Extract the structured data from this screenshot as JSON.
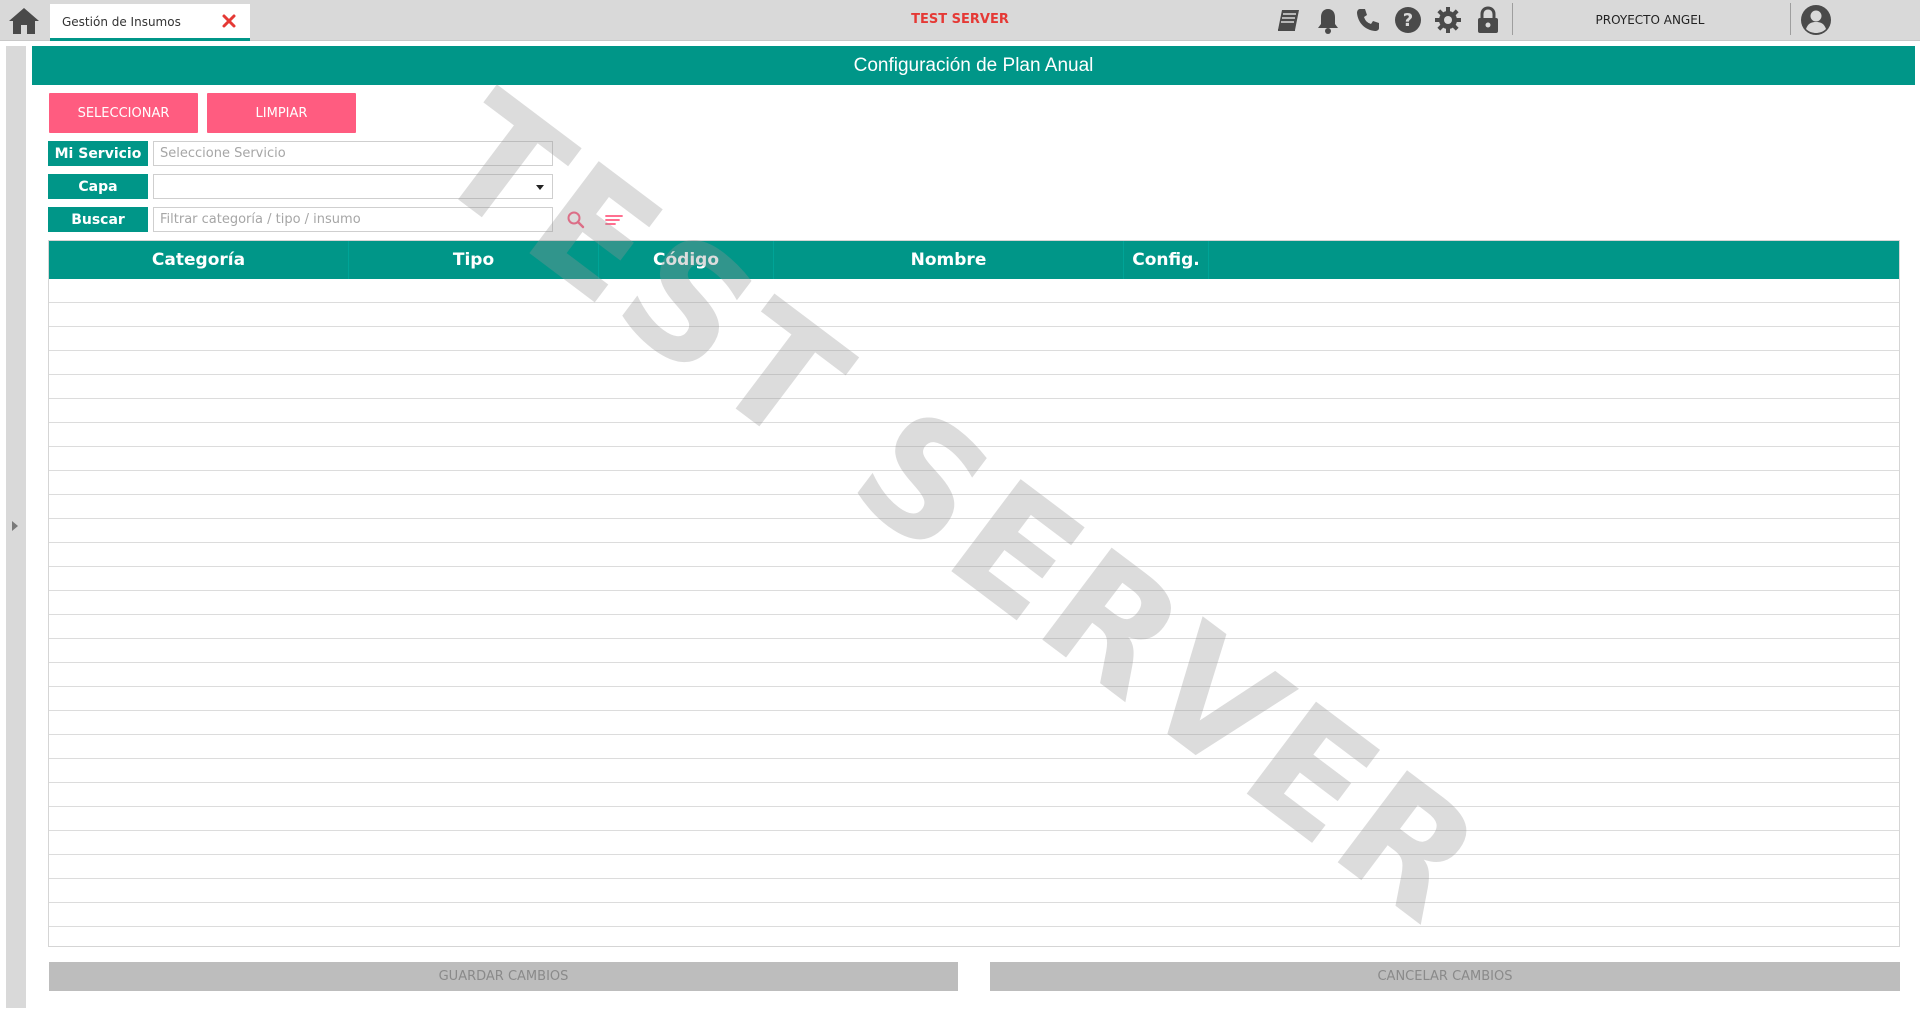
{
  "tabs": [
    {
      "label": "Gestión de Insumos",
      "active": true
    }
  ],
  "topbar": {
    "server_label": "TEST SERVER",
    "project_label": "PROYECTO ANGEL",
    "icons": [
      "home-icon",
      "book-icon",
      "bell-icon",
      "phone-icon",
      "help-icon",
      "gear-icon",
      "lock-icon",
      "user-avatar-icon"
    ]
  },
  "panel": {
    "title": "Configuración de Plan Anual"
  },
  "actions": {
    "select_label": "SELECCIONAR",
    "clear_label": "LIMPIAR"
  },
  "form": {
    "servicio_label": "Mi Servicio",
    "servicio_placeholder": "Seleccione Servicio",
    "capa_label": "Capa",
    "capa_value": "",
    "buscar_label": "Buscar",
    "buscar_placeholder": "Filtrar categoría / tipo / insumo"
  },
  "grid": {
    "columns": [
      "Categoría",
      "Tipo",
      "Código",
      "Nombre",
      "Config."
    ],
    "rows": []
  },
  "watermark": "TEST SERVER",
  "footer": {
    "save_label": "GUARDAR CAMBIOS",
    "cancel_label": "CANCELAR CAMBIOS"
  },
  "colors": {
    "primary": "#009688",
    "accent_pink": "#ff5c80",
    "server_red": "#e53935",
    "disabled": "#bdbdbd"
  }
}
